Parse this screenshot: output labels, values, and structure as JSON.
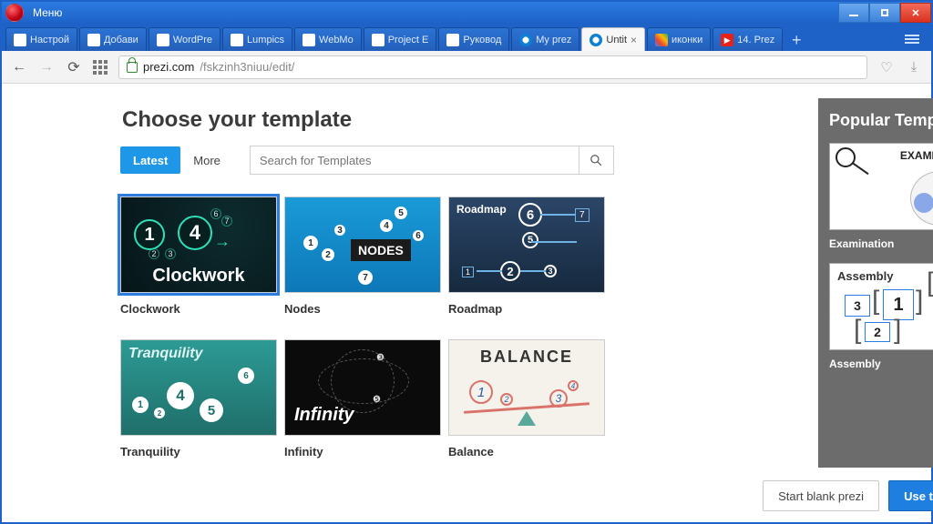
{
  "window": {
    "menu": "Меню"
  },
  "tabs": [
    {
      "label": "Настрой",
      "fav": "plain"
    },
    {
      "label": "Добави",
      "fav": "plain"
    },
    {
      "label": "WordPre",
      "fav": "plain"
    },
    {
      "label": "Lumpics",
      "fav": "plain"
    },
    {
      "label": "WebMo",
      "fav": "plain"
    },
    {
      "label": "Project E",
      "fav": "plain"
    },
    {
      "label": "Руковод",
      "fav": "plain"
    },
    {
      "label": "My prez",
      "fav": "prezi"
    },
    {
      "label": "Untit",
      "fav": "prezi",
      "active": true,
      "closable": true
    },
    {
      "label": "иконки",
      "fav": "g"
    },
    {
      "label": "14. Prez",
      "fav": "yt"
    }
  ],
  "address": {
    "host": "prezi.com",
    "path": "/fskzinh3niuu/edit/"
  },
  "dialog": {
    "heading": "Choose your template",
    "filters": {
      "latest": "Latest",
      "more": "More"
    },
    "search_placeholder": "Search for Templates"
  },
  "templates": [
    {
      "name": "Clockwork"
    },
    {
      "name": "Nodes"
    },
    {
      "name": "Roadmap"
    },
    {
      "name": "Tranquility"
    },
    {
      "name": "Infinity"
    },
    {
      "name": "Balance"
    }
  ],
  "sidebar": {
    "title": "Popular Templates",
    "items": [
      {
        "name": "Examination"
      },
      {
        "name": "Assembly"
      }
    ]
  },
  "footer": {
    "blank": "Start blank prezi",
    "use": "Use template"
  },
  "thumb_text": {
    "clockwork": "Clockwork",
    "nodes": "NODES",
    "roadmap": "Roadmap",
    "tranquility": "Tranquility",
    "infinity": "Infinity",
    "balance": "BALANCE",
    "examination": "EXAMINATION",
    "assembly": "Assembly"
  }
}
